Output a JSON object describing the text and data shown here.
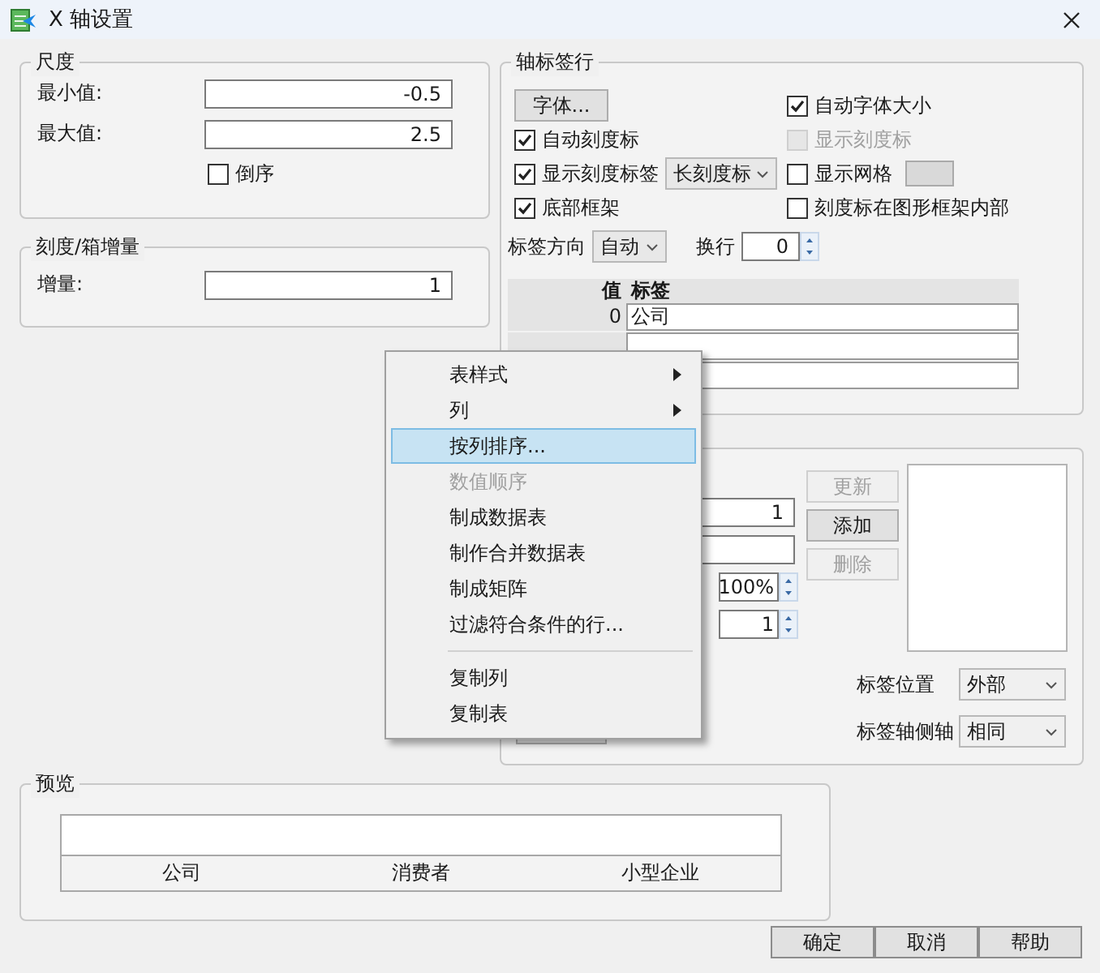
{
  "window": {
    "title": "X 轴设置"
  },
  "scale": {
    "title": "尺度",
    "fields": [
      {
        "label": "最小值:",
        "value": "-0.5"
      },
      {
        "label": "最大值:",
        "value": "2.5"
      }
    ],
    "reverse": {
      "label": "倒序",
      "checked": false
    }
  },
  "increment": {
    "title": "刻度/箱增量",
    "fields": [
      {
        "label": "增量:",
        "value": "1"
      }
    ]
  },
  "axis_labels": {
    "title": "轴标签行",
    "controls": [
      {
        "kind": "button",
        "label": "字体..."
      },
      {
        "kind": "checkbox",
        "label": "自动字体大小",
        "checked": true,
        "disabled": false
      },
      {
        "kind": "checkbox",
        "label": "自动刻度标",
        "checked": true,
        "disabled": false
      },
      {
        "kind": "checkbox",
        "label": "显示刻度标",
        "checked": false,
        "disabled": true
      },
      {
        "kind": "checkbox",
        "label": "显示刻度标签",
        "checked": true,
        "disabled": false,
        "select": "长刻度标"
      },
      {
        "kind": "checkbox",
        "label": "显示网格",
        "checked": false,
        "disabled": false,
        "swatch": true
      },
      {
        "kind": "checkbox",
        "label": "底部框架",
        "checked": true,
        "disabled": false
      },
      {
        "kind": "checkbox",
        "label": "刻度标在图形框架内部",
        "checked": false,
        "disabled": false
      }
    ],
    "orientation": {
      "label": "标签方向",
      "value": "自动"
    },
    "wrap": {
      "label": "换行",
      "value": "0"
    },
    "table": {
      "columns": [
        "值",
        "标签"
      ],
      "rows": [
        {
          "value": "0",
          "label": "公司"
        }
      ]
    }
  },
  "label_panel": {
    "fields": [
      {
        "kind": "input",
        "value": "1"
      },
      {
        "kind": "input"
      },
      {
        "kind": "spinner",
        "value": "100%"
      },
      {
        "kind": "spinner",
        "value": "1"
      }
    ],
    "buttons": [
      {
        "label": "更新",
        "disabled": true
      },
      {
        "label": "添加",
        "disabled": false
      },
      {
        "label": "删除",
        "disabled": true
      }
    ],
    "selects": [
      {
        "label": "标签位置",
        "value": "外部"
      },
      {
        "label": "标签轴侧轴",
        "value": "相同"
      }
    ]
  },
  "preview": {
    "title": "预览",
    "labels": [
      "公司",
      "消费者",
      "小型企业"
    ]
  },
  "buttons": [
    "确定",
    "取消",
    "帮助"
  ],
  "context_menu": {
    "items": [
      {
        "kind": "item",
        "label": "表样式",
        "submenu": true,
        "selected": false,
        "disabled": false
      },
      {
        "kind": "item",
        "label": "列",
        "submenu": true,
        "selected": false,
        "disabled": false
      },
      {
        "kind": "item",
        "label": "按列排序...",
        "submenu": false,
        "selected": true,
        "disabled": false
      },
      {
        "kind": "item",
        "label": "数值顺序",
        "submenu": false,
        "selected": false,
        "disabled": true
      },
      {
        "kind": "item",
        "label": "制成数据表",
        "submenu": false,
        "selected": false,
        "disabled": false
      },
      {
        "kind": "item",
        "label": "制作合并数据表",
        "submenu": false,
        "selected": false,
        "disabled": false
      },
      {
        "kind": "item",
        "label": "制成矩阵",
        "submenu": false,
        "selected": false,
        "disabled": false
      },
      {
        "kind": "item",
        "label": "过滤符合条件的行...",
        "submenu": false,
        "selected": false,
        "disabled": false
      },
      {
        "kind": "separator"
      },
      {
        "kind": "item",
        "label": "复制列",
        "submenu": false,
        "selected": false,
        "disabled": false
      },
      {
        "kind": "item",
        "label": "复制表",
        "submenu": false,
        "selected": false,
        "disabled": false
      }
    ]
  }
}
